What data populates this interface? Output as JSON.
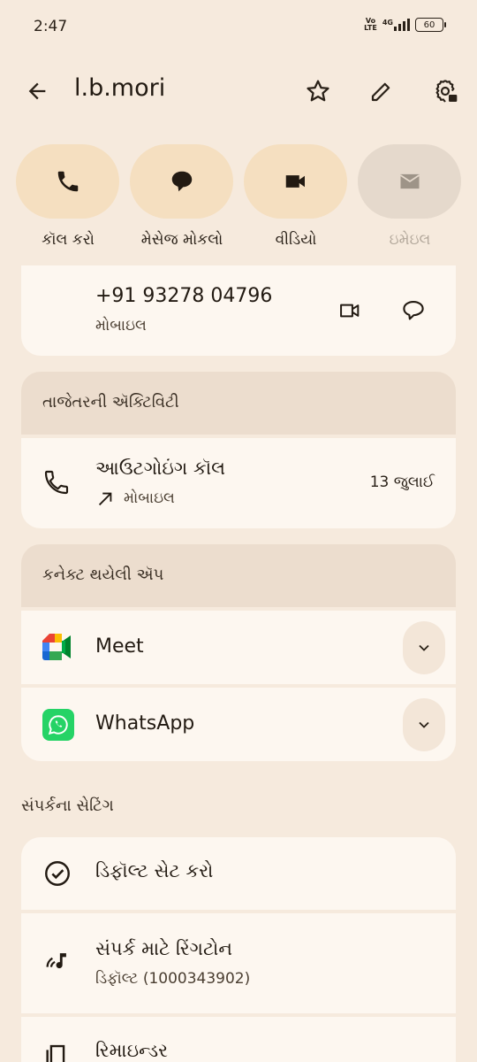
{
  "status": {
    "time": "2:47",
    "volte": "Vo\nLTE",
    "network": "4G",
    "battery": "60"
  },
  "header": {
    "title": "l.b.mori"
  },
  "actions": [
    {
      "label": "કૉલ કરો",
      "icon": "phone-icon"
    },
    {
      "label": "મેસેજ મોકલો",
      "icon": "message-icon"
    },
    {
      "label": "વીડિયો",
      "icon": "video-icon"
    },
    {
      "label": "ઇમેઇલ",
      "icon": "email-icon",
      "disabled": true
    }
  ],
  "phone": {
    "number": "+91 93278 04796",
    "type": "મોબાઇલ"
  },
  "recent": {
    "heading": "તાજેતરની ઍક્ટિવિટી",
    "title": "આઉટગોઇંગ કૉલ",
    "subtitle": "મોબાઇલ",
    "date": "13 જુલાઈ"
  },
  "apps": {
    "heading": "કનેક્ટ થયેલી ઍપ",
    "items": [
      {
        "name": "Meet",
        "icon": "google-meet-icon"
      },
      {
        "name": "WhatsApp",
        "icon": "whatsapp-icon"
      }
    ]
  },
  "settings": {
    "heading": "સંપર્કના સેટિંગ",
    "items": [
      {
        "title": "ડિફૉલ્ટ સેટ કરો",
        "icon": "check-circle-icon"
      },
      {
        "title": "સંપર્ક માટે રિંગટોન",
        "subtitle": "ડિફૉલ્ટ (1000343902)",
        "icon": "ringtone-icon"
      },
      {
        "title": "રિમાઇન્ડર",
        "icon": "reminder-icon"
      }
    ]
  },
  "colors": {
    "background": "#f6eadd",
    "action_bg": "#f5dfc0",
    "card_bg": "#fdf7f0",
    "section_bg": "#ecddce"
  }
}
